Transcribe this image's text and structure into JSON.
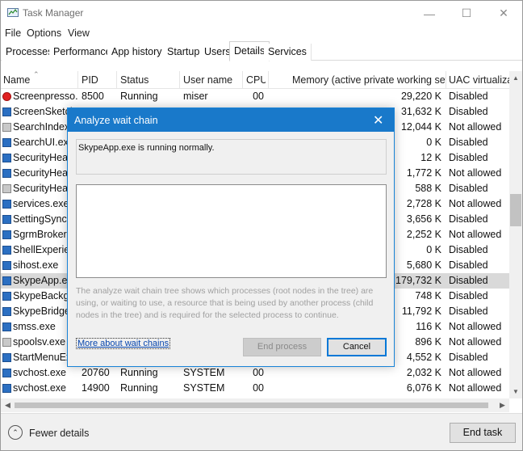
{
  "window": {
    "title": "Task Manager"
  },
  "menubar": {
    "items": [
      "File",
      "Options",
      "View"
    ]
  },
  "tabs": [
    "Processes",
    "Performance",
    "App history",
    "Startup",
    "Users",
    "Details",
    "Services"
  ],
  "active_tab": "Details",
  "columns": [
    "Name",
    "PID",
    "Status",
    "User name",
    "CPU",
    "Memory (active private working set)",
    "UAC virtualizat"
  ],
  "rows": [
    {
      "name": "Screenpresso...",
      "pid": "8500",
      "status": "Running",
      "user": "miser",
      "cpu": "00",
      "mem": "29,220 K",
      "uac": "Disabled",
      "icon": "screenpresso-icon"
    },
    {
      "name": "ScreenSketch",
      "pid": "",
      "status": "",
      "user": "",
      "cpu": "",
      "mem": "31,632 K",
      "uac": "Disabled",
      "icon": "app-icon"
    },
    {
      "name": "SearchIndexe",
      "pid": "",
      "status": "",
      "user": "",
      "cpu": "",
      "mem": "12,044 K",
      "uac": "Not allowed",
      "icon": "search-indexer-icon"
    },
    {
      "name": "SearchUI.exe",
      "pid": "",
      "status": "",
      "user": "",
      "cpu": "",
      "mem": "0 K",
      "uac": "Disabled",
      "icon": "app-icon"
    },
    {
      "name": "SecurityHealt",
      "pid": "",
      "status": "",
      "user": "",
      "cpu": "",
      "mem": "12 K",
      "uac": "Disabled",
      "icon": "app-icon"
    },
    {
      "name": "SecurityHealt",
      "pid": "",
      "status": "",
      "user": "",
      "cpu": "",
      "mem": "1,772 K",
      "uac": "Not allowed",
      "icon": "app-icon"
    },
    {
      "name": "SecurityHealt",
      "pid": "",
      "status": "",
      "user": "",
      "cpu": "",
      "mem": "588 K",
      "uac": "Disabled",
      "icon": "shield-icon"
    },
    {
      "name": "services.exe",
      "pid": "",
      "status": "",
      "user": "",
      "cpu": "",
      "mem": "2,728 K",
      "uac": "Not allowed",
      "icon": "app-icon"
    },
    {
      "name": "SettingSyncH",
      "pid": "",
      "status": "",
      "user": "",
      "cpu": "",
      "mem": "3,656 K",
      "uac": "Disabled",
      "icon": "app-icon"
    },
    {
      "name": "SgrmBroker.e",
      "pid": "",
      "status": "",
      "user": "",
      "cpu": "",
      "mem": "2,252 K",
      "uac": "Not allowed",
      "icon": "app-icon"
    },
    {
      "name": "ShellExperien",
      "pid": "",
      "status": "",
      "user": "",
      "cpu": "",
      "mem": "0 K",
      "uac": "Disabled",
      "icon": "app-icon"
    },
    {
      "name": "sihost.exe",
      "pid": "",
      "status": "",
      "user": "",
      "cpu": "",
      "mem": "5,680 K",
      "uac": "Disabled",
      "icon": "app-icon"
    },
    {
      "name": "SkypeApp.ex",
      "pid": "",
      "status": "",
      "user": "",
      "cpu": "",
      "mem": "179,732 K",
      "uac": "Disabled",
      "icon": "app-icon",
      "selected": true
    },
    {
      "name": "SkypeBackgr",
      "pid": "",
      "status": "",
      "user": "",
      "cpu": "",
      "mem": "748 K",
      "uac": "Disabled",
      "icon": "app-icon"
    },
    {
      "name": "SkypeBridge.",
      "pid": "",
      "status": "",
      "user": "",
      "cpu": "",
      "mem": "11,792 K",
      "uac": "Disabled",
      "icon": "app-icon"
    },
    {
      "name": "smss.exe",
      "pid": "",
      "status": "",
      "user": "",
      "cpu": "",
      "mem": "116 K",
      "uac": "Not allowed",
      "icon": "app-icon"
    },
    {
      "name": "spoolsv.exe",
      "pid": "",
      "status": "",
      "user": "",
      "cpu": "",
      "mem": "896 K",
      "uac": "Not allowed",
      "icon": "printer-icon"
    },
    {
      "name": "StartMenuEx",
      "pid": "",
      "status": "",
      "user": "",
      "cpu": "",
      "mem": "4,552 K",
      "uac": "Disabled",
      "icon": "app-icon"
    },
    {
      "name": "svchost.exe",
      "pid": "20760",
      "status": "Running",
      "user": "SYSTEM",
      "cpu": "00",
      "mem": "2,032 K",
      "uac": "Not allowed",
      "icon": "app-icon"
    },
    {
      "name": "svchost.exe",
      "pid": "14900",
      "status": "Running",
      "user": "SYSTEM",
      "cpu": "00",
      "mem": "6,076 K",
      "uac": "Not allowed",
      "icon": "app-icon"
    }
  ],
  "footer": {
    "fewer_details": "Fewer details",
    "end_task": "End task"
  },
  "dialog": {
    "title": "Analyze wait chain",
    "status": "SkypeApp.exe is running normally.",
    "description": "The analyze wait chain tree shows which processes (root nodes in the tree) are using, or waiting to use, a resource that is being used by another process (child nodes in the tree) and is required for the selected process to continue.",
    "link": "More about wait chains",
    "end_process": "End process",
    "cancel": "Cancel"
  },
  "colors": {
    "accent": "#1979ca",
    "selection": "#d9d9d9",
    "link": "#0645ad"
  }
}
